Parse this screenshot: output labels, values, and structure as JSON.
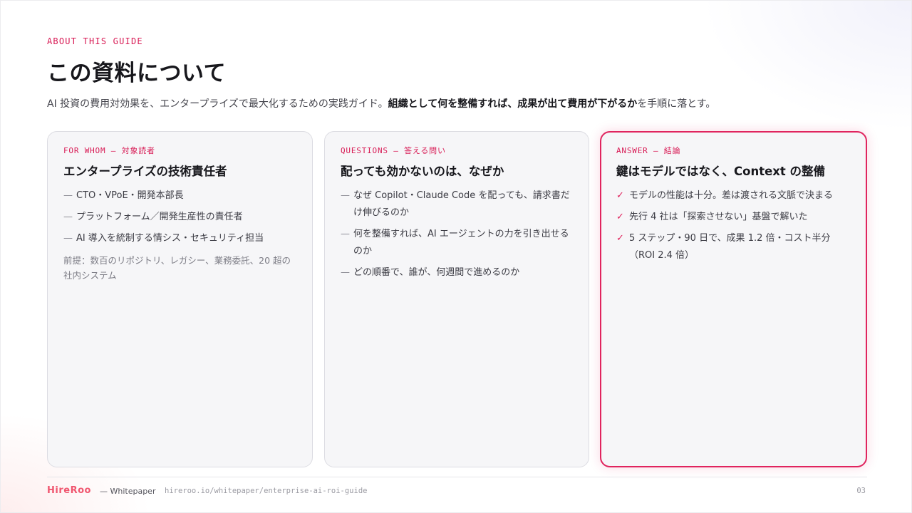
{
  "header": {
    "eyebrow": "ABOUT THIS GUIDE",
    "title": "この資料について",
    "lead_prefix": "AI 投資の費用対効果を、エンタープライズで最大化するための実践ガイド。",
    "lead_bold": "組織として何を整備すれば、成果が出て費用が下がるか",
    "lead_suffix": "を手順に落とす。"
  },
  "cards": [
    {
      "tag": "FOR WHOM — 対象読者",
      "title": "エンタープライズの技術責任者",
      "mark": "—",
      "items": [
        "CTO・VPoE・開発本部長",
        "プラットフォーム／開発生産性の責任者",
        "AI 導入を統制する情シス・セキュリティ担当"
      ],
      "note": "前提：数百のリポジトリ、レガシー、業務委託、20 超の社内システム"
    },
    {
      "tag": "QUESTIONS — 答える問い",
      "title": "配っても効かないのは、なぜか",
      "mark": "—",
      "items": [
        "なぜ Copilot・Claude Code を配っても、請求書だけ伸びるのか",
        "何を整備すれば、AI エージェントの力を引き出せるのか",
        "どの順番で、誰が、何週間で進めるのか"
      ]
    },
    {
      "tag": "ANSWER — 結論",
      "title": "鍵はモデルではなく、Context の整備",
      "mark": "✓",
      "items": [
        "モデルの性能は十分。差は渡される文脈で決まる",
        "先行 4 社は「探索させない」基盤で解いた",
        "5 ステップ・90 日で、成果 1.2 倍・コスト半分（ROI 2.4 倍）"
      ]
    }
  ],
  "footer": {
    "brand": "HireRoo",
    "brand_sub": "— Whitepaper",
    "url": "hireroo.io/whitepaper/enterprise-ai-roi-guide",
    "page": "03"
  },
  "colors": {
    "accent": "#e0245e",
    "brand": "#f0566f"
  }
}
